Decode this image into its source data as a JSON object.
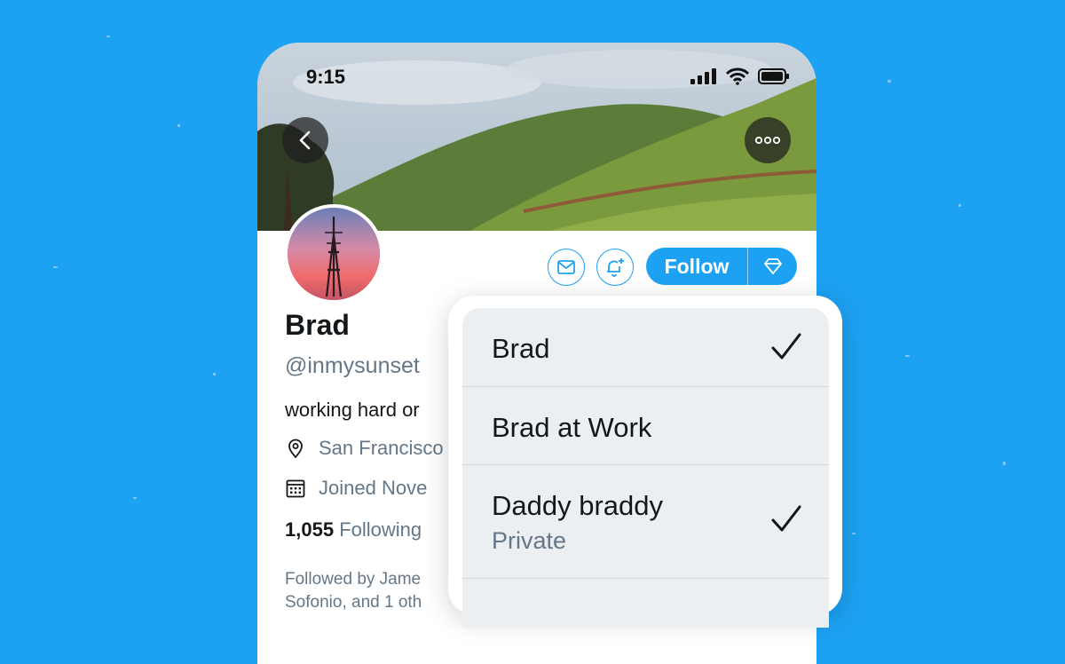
{
  "statusbar": {
    "time": "9:15"
  },
  "profile": {
    "name": "Brad",
    "handle": "@inmysunset",
    "bio": "working hard or",
    "location": "San Francisco",
    "joined": "Joined Nove",
    "following_count": "1,055",
    "following_label": "Following",
    "followed_by_line1": "Followed by Jame",
    "followed_by_line2": "Sofonio, and 1 oth"
  },
  "actions": {
    "follow_label": "Follow"
  },
  "account_menu": {
    "items": [
      {
        "label": "Brad",
        "checked": true
      },
      {
        "label": "Brad at Work",
        "checked": false
      },
      {
        "label": "Daddy braddy",
        "sublabel": "Private",
        "checked": true
      }
    ]
  },
  "colors": {
    "brand": "#1da1f2",
    "text_primary": "#14171a",
    "text_secondary": "#657786"
  }
}
